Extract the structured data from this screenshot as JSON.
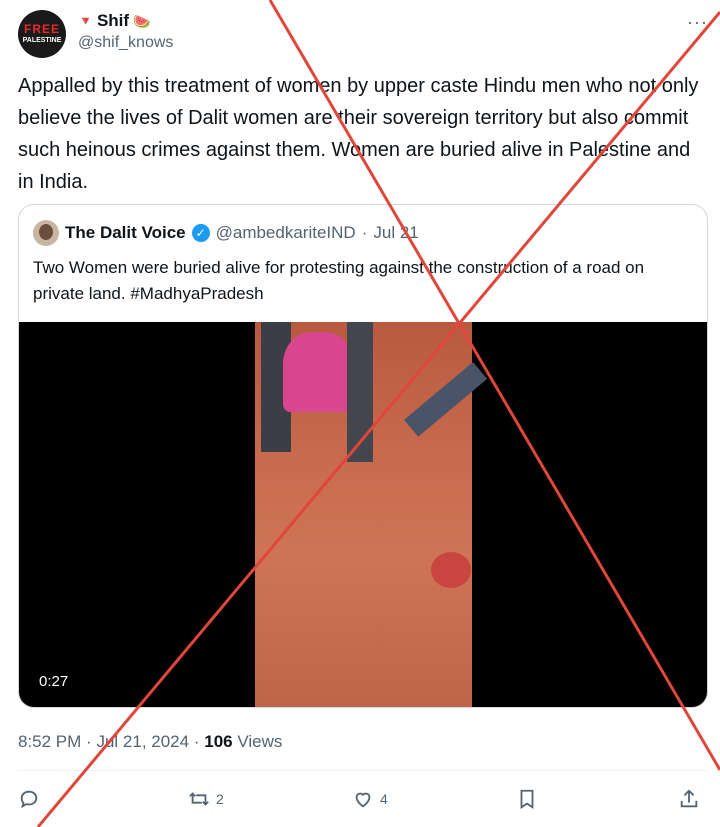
{
  "author": {
    "name": "Shif",
    "heart": "🔻",
    "emoji": "🍉",
    "handle": "@shif_knows",
    "avatar_text_top": "FREE",
    "avatar_text_bottom": "PALESTINE"
  },
  "more_label": "···",
  "tweet_text": "Appalled by this treatment of women by upper caste Hindu men who not only believe the lives of Dalit women are their sovereign territory but also commit such heinous crimes against them. Women are buried alive in Palestine and in India.",
  "quote": {
    "name": "The Dalit Voice",
    "verified_icon": "verified-badge",
    "handle": "@ambedkariteIND",
    "separator": "·",
    "date": "Jul 21",
    "text": "Two Women were buried alive for protesting against the construction of a road on private land. #MadhyaPradesh",
    "video_duration": "0:27"
  },
  "timestamp": {
    "time": "8:52 PM",
    "sep1": "·",
    "date": "Jul 21, 2024",
    "sep2": "·",
    "views_count": "106",
    "views_label": "Views"
  },
  "actions": {
    "reply_icon": "reply-icon",
    "retweet_count": "2",
    "like_count": "4",
    "bookmark_icon": "bookmark-icon",
    "share_icon": "share-icon"
  },
  "colors": {
    "cross": "#e0463a",
    "verified": "#1d9bf0",
    "muted": "#536471"
  }
}
